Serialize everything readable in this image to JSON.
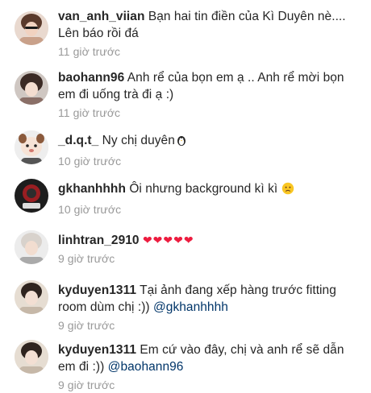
{
  "comments": [
    {
      "username": "van_anh_viian",
      "text": "Bạn hai tin điền của Kì Duyên nè.... Lên báo rồi đá",
      "mention": "",
      "time": "11 giờ trước"
    },
    {
      "username": "baohann96",
      "text": "Anh rể của bọn em ạ .. Anh rể mời bọn em đi uống trà đi ạ :)",
      "mention": "",
      "time": "11 giờ trước"
    },
    {
      "username": "_d.q.t_",
      "text": "Ny chị duyên",
      "mention": "",
      "emoji": "penguin",
      "time": "10 giờ trước"
    },
    {
      "username": "gkhanhhhh",
      "text": "Ôi nhưng background kì kì",
      "mention": "",
      "emoji": "worried-face",
      "time": "10 giờ trước"
    },
    {
      "username": "linhtran_2910",
      "text": "",
      "mention": "",
      "hearts": "❤❤❤❤❤",
      "time": "9 giờ trước"
    },
    {
      "username": "kyduyen1311",
      "text": "Tại ảnh đang xếp hàng trước fitting room dùm chị :))",
      "mention": "@gkhanhhhh",
      "time": "9 giờ trước"
    },
    {
      "username": "kyduyen1311",
      "text": "Em cứ vào đây, chị và anh rể sẽ dẫn em đi :))",
      "mention": "@baohann96",
      "time": "9 giờ trước"
    }
  ],
  "colors": {
    "username": "#262626",
    "text": "#262626",
    "mention": "#003569",
    "time": "#999999",
    "heart": "#ed1c3f"
  }
}
